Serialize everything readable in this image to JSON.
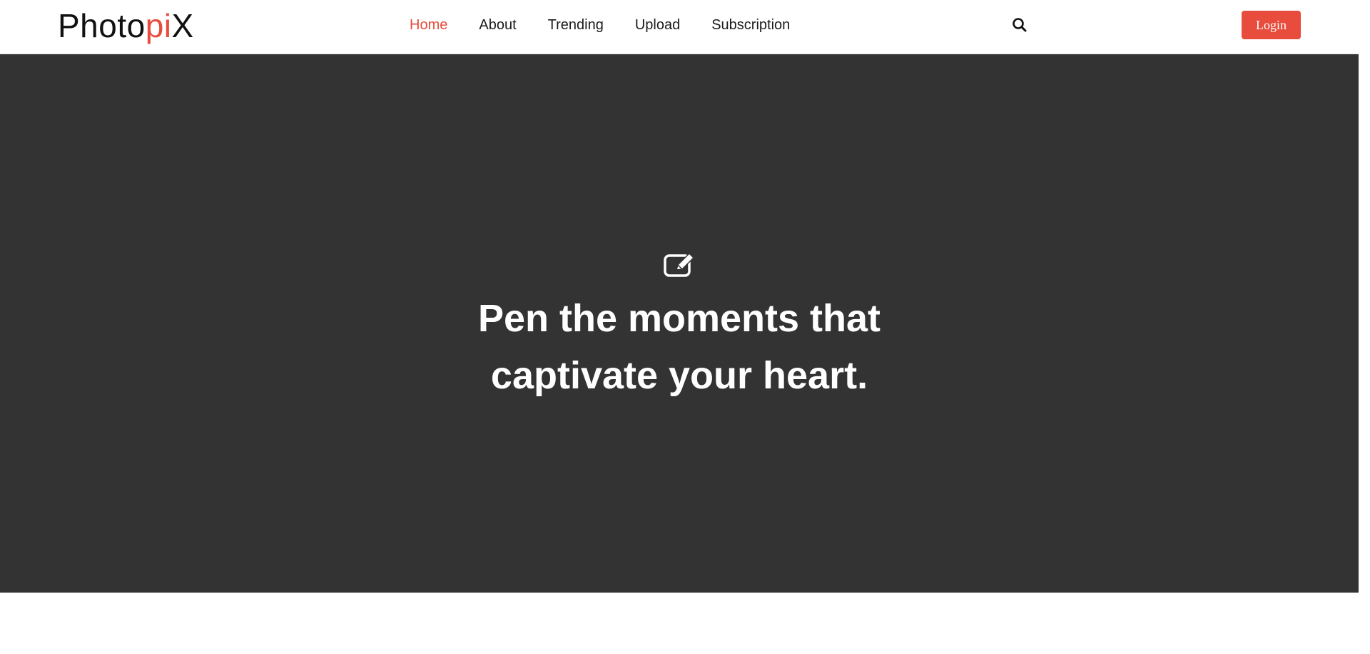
{
  "brand": {
    "logo_part1": "Photo",
    "logo_part2": "pi",
    "logo_part3": "X",
    "accent_color": "#e74c3c"
  },
  "nav": {
    "items": [
      {
        "label": "Home",
        "active": true
      },
      {
        "label": "About",
        "active": false
      },
      {
        "label": "Trending",
        "active": false
      },
      {
        "label": "Upload",
        "active": false
      },
      {
        "label": "Subscription",
        "active": false
      }
    ]
  },
  "header": {
    "search_icon": "search-icon",
    "login_label": "Login"
  },
  "hero": {
    "icon": "edit-icon",
    "title_line1": "Pen the moments that",
    "title_line2": "captivate your heart.",
    "background_color": "#333333"
  }
}
